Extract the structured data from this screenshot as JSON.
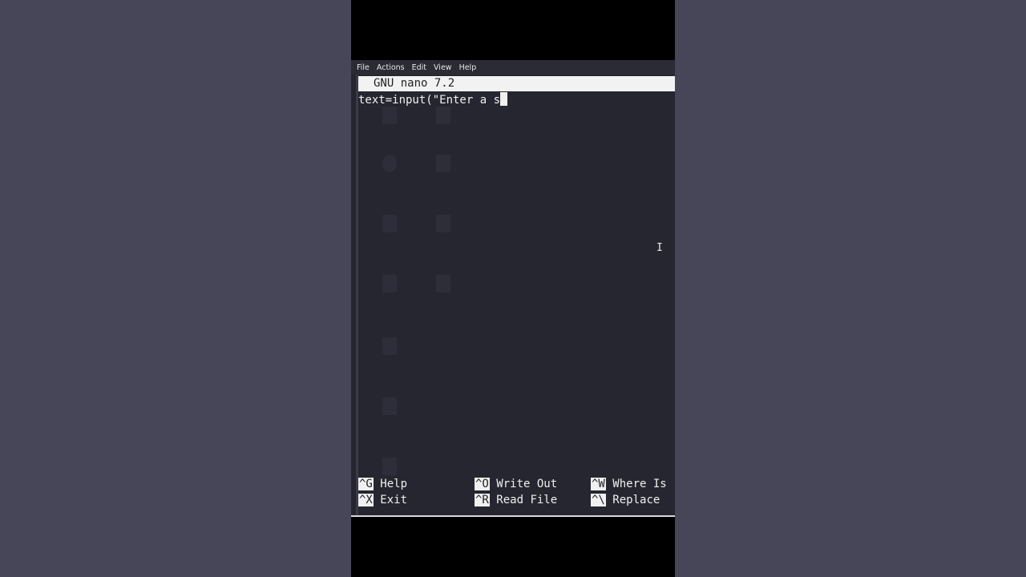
{
  "menu": {
    "items": [
      "File",
      "Actions",
      "Edit",
      "View",
      "Help"
    ]
  },
  "nano": {
    "title": "GNU nano 7.2",
    "buffer_line": "text=input(\"Enter a s"
  },
  "shortcuts": [
    {
      "key": "^G",
      "label": "Help"
    },
    {
      "key": "^O",
      "label": "Write Out"
    },
    {
      "key": "^W",
      "label": "Where Is"
    },
    {
      "key": "^X",
      "label": "Exit"
    },
    {
      "key": "^R",
      "label": "Read File"
    },
    {
      "key": "^\\",
      "label": "Replace"
    }
  ],
  "mouse_cursor_icon": "text-cursor-icon",
  "colors": {
    "background_side": "#474659",
    "terminal_bg": "#262630",
    "title_bar": "#f2f2f2"
  }
}
